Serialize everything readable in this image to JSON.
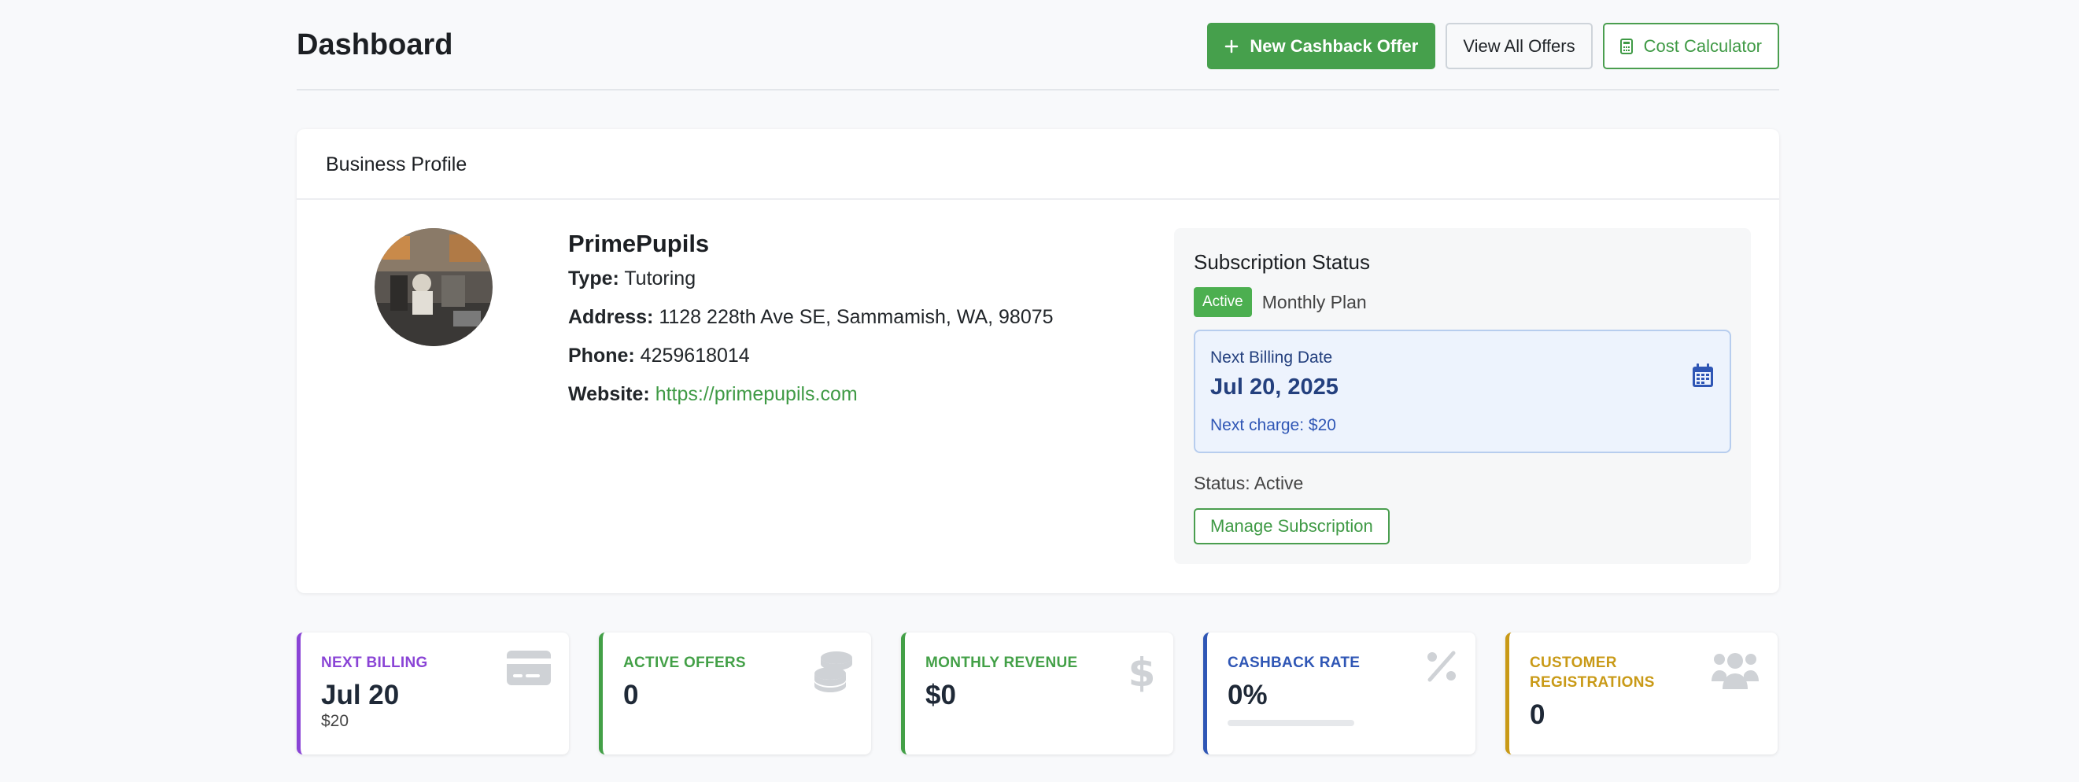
{
  "header": {
    "title": "Dashboard",
    "new_offer_label": "New Cashback Offer",
    "view_all_label": "View All Offers",
    "calculator_label": "Cost Calculator"
  },
  "profile": {
    "card_title": "Business Profile",
    "name": "PrimePupils",
    "type_key": "Type:",
    "type": "Tutoring",
    "address_key": "Address:",
    "address": "1128 228th Ave SE, Sammamish, WA, 98075",
    "phone_key": "Phone:",
    "phone": "4259618014",
    "website_key": "Website:",
    "website": "https://primepupils.com"
  },
  "subscription": {
    "title": "Subscription Status",
    "badge": "Active",
    "plan": "Monthly Plan",
    "billing_label": "Next Billing Date",
    "billing_date": "Jul 20, 2025",
    "next_charge": "Next charge: $20",
    "status": "Status: Active",
    "manage_label": "Manage Subscription"
  },
  "stats": [
    {
      "label": "NEXT BILLING",
      "value": "Jul 20",
      "sub": "$20",
      "color": "#8a44d6",
      "icon": "credit-card-icon"
    },
    {
      "label": "ACTIVE OFFERS",
      "value": "0",
      "color": "#43a047",
      "icon": "coins-icon"
    },
    {
      "label": "MONTHLY REVENUE",
      "value": "$0",
      "color": "#43a047",
      "icon": "dollar-icon"
    },
    {
      "label": "CASHBACK RATE",
      "value": "0%",
      "color": "#2f56b5",
      "icon": "percent-icon",
      "progress": 0
    },
    {
      "label": "CUSTOMER REGISTRATIONS",
      "value": "0",
      "color": "#c99a17",
      "icon": "users-icon"
    }
  ],
  "colors": {
    "accent_green": "#46a04c",
    "billing_blue": "#24407e",
    "icon_gray": "#cfd2d6"
  }
}
